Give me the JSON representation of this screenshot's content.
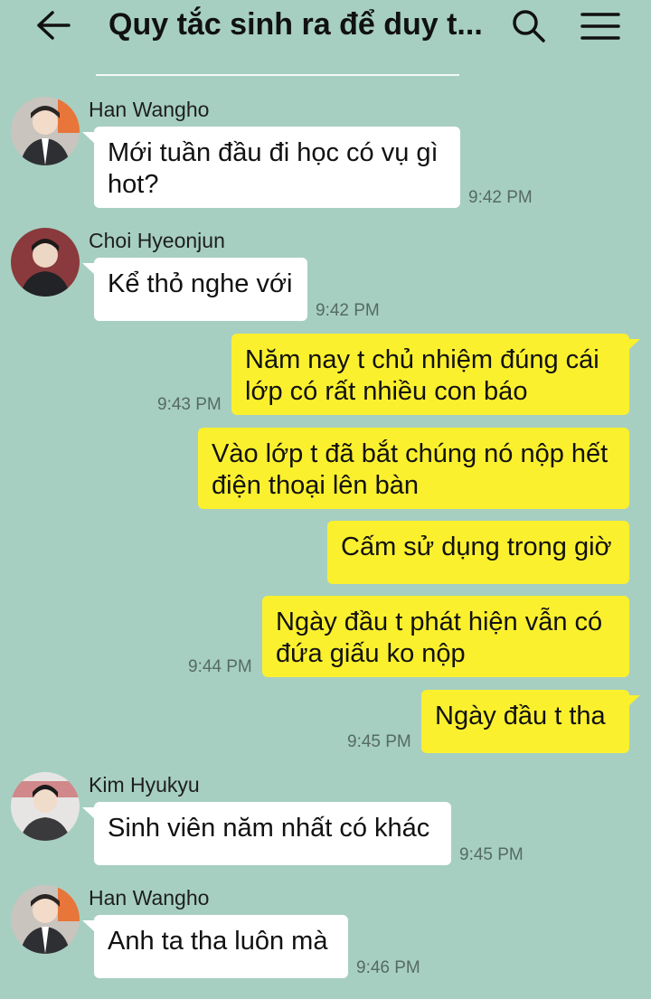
{
  "header": {
    "title": "Quy tắc sinh ra để duy t...",
    "back_icon": "arrow-left-icon",
    "search_icon": "search-icon",
    "menu_icon": "hamburger-menu-icon"
  },
  "colors": {
    "background": "#a6cfc1",
    "incoming_bubble": "#ffffff",
    "outgoing_bubble": "#fbf02e"
  },
  "messages": [
    {
      "sender": "Han Wangho",
      "text": "Mới tuần đầu đi học có vụ gì hot?",
      "time": "9:42 PM"
    },
    {
      "sender": "Choi Hyeonjun",
      "text": "Kể thỏ nghe với",
      "time": "9:42 PM"
    },
    {
      "text": "Năm nay t chủ nhiệm đúng cái lớp có rất nhiều con báo",
      "time": "9:43 PM"
    },
    {
      "text": "Vào lớp t đã bắt chúng nó nộp hết điện thoại lên bàn"
    },
    {
      "text": "Cấm sử dụng trong giờ"
    },
    {
      "text": "Ngày đầu t phát hiện vẫn có đứa giấu ko nộp",
      "time": "9:44 PM"
    },
    {
      "text": "Ngày đầu t tha",
      "time": "9:45 PM"
    },
    {
      "sender": "Kim Hyukyu",
      "text": "Sinh viên năm nhất có khác",
      "time": "9:45 PM"
    },
    {
      "sender": "Han Wangho",
      "text": "Anh ta tha luôn mà",
      "time": "9:46 PM"
    }
  ]
}
